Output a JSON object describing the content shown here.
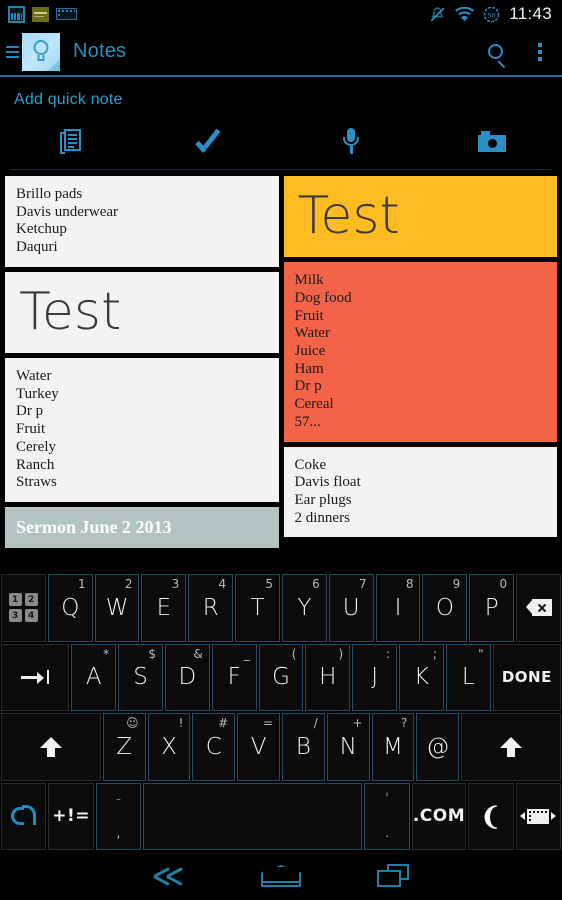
{
  "statusbar": {
    "notifications": [
      "screenshot-icon",
      "app-icon",
      "keyboard-icon"
    ],
    "mute_icon": "mute-bell-icon",
    "wifi_icon": "wifi-icon",
    "battery_level": "50",
    "time": "11:43"
  },
  "actionbar": {
    "drawer_icon": "hamburger-menu-icon",
    "app_icon": "notes-lightbulb-icon",
    "title": "Notes",
    "search_icon": "search-icon",
    "overflow_icon": "overflow-menu-icon",
    "accent": "#2790c4"
  },
  "quicknote": {
    "label": "Add quick note",
    "buttons": [
      {
        "name": "text-note",
        "icon": "text-note-icon"
      },
      {
        "name": "checklist-note",
        "icon": "checkmark-icon"
      },
      {
        "name": "voice-note",
        "icon": "microphone-icon"
      },
      {
        "name": "photo-note",
        "icon": "camera-icon"
      }
    ]
  },
  "notes": {
    "left_column": [
      {
        "type": "list",
        "bg": "#f3f3f1",
        "lines": [
          "Brillo pads",
          "Davis underwear",
          "Ketchup",
          "Daquri"
        ]
      },
      {
        "type": "title",
        "bg": "#f3f3f1",
        "text": "Test"
      },
      {
        "type": "list",
        "bg": "#f3f3f1",
        "lines": [
          "Water",
          "Turkey",
          "Dr p",
          "Fruit",
          "Cerely",
          "Ranch",
          "Straws"
        ]
      },
      {
        "type": "heading",
        "bg": "#b2c3c2",
        "text": "Sermon  June 2 2013"
      }
    ],
    "right_column": [
      {
        "type": "title",
        "bg": "#ffbb22",
        "text": "Test"
      },
      {
        "type": "list",
        "bg": "#f26347",
        "lines": [
          "Milk",
          "Dog food",
          "Fruit",
          "Water",
          "Juice",
          "Ham",
          "Dr p",
          "Cereal",
          "57..."
        ]
      },
      {
        "type": "list",
        "bg": "#f3f3f1",
        "lines": [
          "Coke",
          "Davis float",
          "Ear plugs",
          "2 dinners"
        ]
      }
    ]
  },
  "keyboard": {
    "row1": [
      {
        "type": "icon",
        "name": "numpad-key",
        "glyph": "numpad-icon",
        "pad": [
          "1",
          "2",
          "3",
          "4"
        ],
        "cls": "fn"
      },
      {
        "type": "key",
        "main": "Q",
        "alt": "1"
      },
      {
        "type": "key",
        "main": "W",
        "alt": "2"
      },
      {
        "type": "key",
        "main": "E",
        "alt": "3"
      },
      {
        "type": "key",
        "main": "R",
        "alt": "4"
      },
      {
        "type": "key",
        "main": "T",
        "alt": "5"
      },
      {
        "type": "key",
        "main": "Y",
        "alt": "6"
      },
      {
        "type": "key",
        "main": "U",
        "alt": "7"
      },
      {
        "type": "key",
        "main": "I",
        "alt": "8"
      },
      {
        "type": "key",
        "main": "O",
        "alt": "9"
      },
      {
        "type": "key",
        "main": "P",
        "alt": "0"
      },
      {
        "type": "icon",
        "name": "backspace-key",
        "glyph": "backspace-icon",
        "cls": "fn"
      }
    ],
    "row2": [
      {
        "type": "icon",
        "name": "tab-key",
        "glyph": "tab-icon",
        "cls": "fn wide"
      },
      {
        "type": "key",
        "main": "A",
        "alt": "*"
      },
      {
        "type": "key",
        "main": "S",
        "alt": "$"
      },
      {
        "type": "key",
        "main": "D",
        "alt": "&"
      },
      {
        "type": "key",
        "main": "F",
        "alt": "_"
      },
      {
        "type": "key",
        "main": "G",
        "alt": "("
      },
      {
        "type": "key",
        "main": "H",
        "alt": ")"
      },
      {
        "type": "key",
        "main": "J",
        "alt": ":"
      },
      {
        "type": "key",
        "main": "K",
        "alt": ";"
      },
      {
        "type": "key",
        "main": "L",
        "alt": "\""
      },
      {
        "type": "text",
        "name": "done-key",
        "main": "DONE",
        "cls": "fn wide"
      }
    ],
    "row3": [
      {
        "type": "icon",
        "name": "shift-left-key",
        "glyph": "shift-icon",
        "cls": "fn shift"
      },
      {
        "type": "key",
        "main": "Z",
        "alt": "☺"
      },
      {
        "type": "key",
        "main": "X",
        "alt": "!"
      },
      {
        "type": "key",
        "main": "C",
        "alt": "#"
      },
      {
        "type": "key",
        "main": "V",
        "alt": "="
      },
      {
        "type": "key",
        "main": "B",
        "alt": "/"
      },
      {
        "type": "key",
        "main": "N",
        "alt": "+"
      },
      {
        "type": "key",
        "main": "M",
        "alt": "?"
      },
      {
        "type": "key",
        "main": "@",
        "alt": ""
      },
      {
        "type": "icon",
        "name": "shift-right-key",
        "glyph": "shift-icon",
        "cls": "fn shift"
      }
    ],
    "row4": [
      {
        "type": "icon",
        "name": "swipe-trace-key",
        "glyph": "swipe-trace-icon",
        "cls": "fn"
      },
      {
        "type": "text",
        "name": "symbols-key",
        "main": "+!=",
        "cls": "fn small"
      },
      {
        "type": "stack",
        "name": "comma-key",
        "up": "-",
        "dn": ","
      },
      {
        "type": "text",
        "name": "space-key",
        "main": "",
        "cls": "space"
      },
      {
        "type": "stack",
        "name": "period-key",
        "up": "'",
        "dn": "."
      },
      {
        "type": "text",
        "name": "dotcom-key",
        "main": ".COM",
        "cls": "fn small"
      },
      {
        "type": "icon",
        "name": "swype-logo-key",
        "glyph": "swype-flame-icon",
        "flame": "❨",
        "cls": "fn"
      },
      {
        "type": "icon",
        "name": "keyboard-switch-key",
        "glyph": "keyboard-switch-icon",
        "cls": "fn"
      }
    ]
  },
  "navbar": {
    "back": "back-icon",
    "home": "home-icon",
    "recents": "recent-apps-icon",
    "color": "#1e7fa8"
  }
}
